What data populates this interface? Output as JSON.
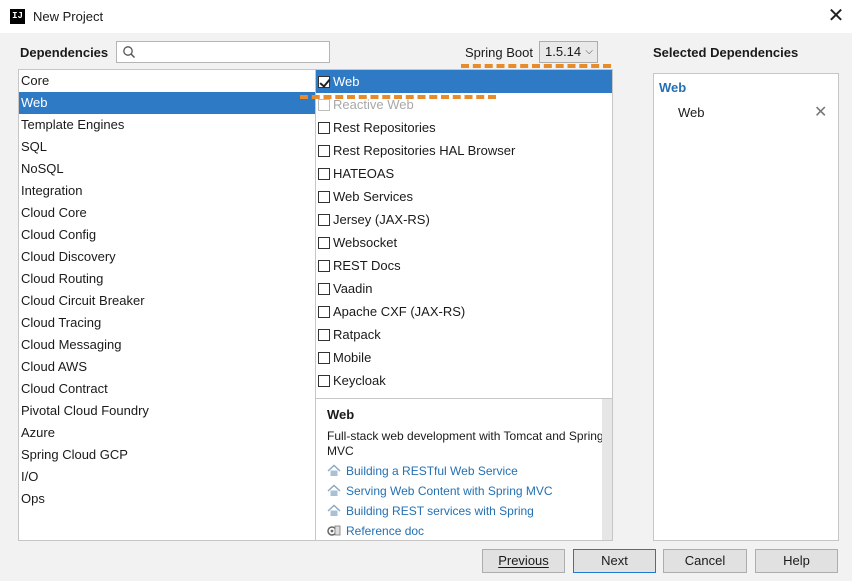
{
  "window": {
    "title": "New Project",
    "app_icon_text": "IJ",
    "close_glyph": "✕"
  },
  "header": {
    "dependencies_label": "Dependencies",
    "search": {
      "value": "",
      "placeholder": ""
    },
    "spring_boot_label": "Spring Boot",
    "spring_boot_version": "1.5.14",
    "selected_title": "Selected Dependencies"
  },
  "categories": [
    {
      "label": "Core"
    },
    {
      "label": "Web"
    },
    {
      "label": "Template Engines"
    },
    {
      "label": "SQL"
    },
    {
      "label": "NoSQL"
    },
    {
      "label": "Integration"
    },
    {
      "label": "Cloud Core"
    },
    {
      "label": "Cloud Config"
    },
    {
      "label": "Cloud Discovery"
    },
    {
      "label": "Cloud Routing"
    },
    {
      "label": "Cloud Circuit Breaker"
    },
    {
      "label": "Cloud Tracing"
    },
    {
      "label": "Cloud Messaging"
    },
    {
      "label": "Cloud AWS"
    },
    {
      "label": "Cloud Contract"
    },
    {
      "label": "Pivotal Cloud Foundry"
    },
    {
      "label": "Azure"
    },
    {
      "label": "Spring Cloud GCP"
    },
    {
      "label": "I/O"
    },
    {
      "label": "Ops"
    }
  ],
  "selected_category": "Web",
  "dependencies": [
    {
      "label": "Web",
      "checked": true,
      "disabled": false
    },
    {
      "label": "Reactive Web",
      "checked": false,
      "disabled": true
    },
    {
      "label": "Rest Repositories",
      "checked": false,
      "disabled": false
    },
    {
      "label": "Rest Repositories HAL Browser",
      "checked": false,
      "disabled": false
    },
    {
      "label": "HATEOAS",
      "checked": false,
      "disabled": false
    },
    {
      "label": "Web Services",
      "checked": false,
      "disabled": false
    },
    {
      "label": "Jersey (JAX-RS)",
      "checked": false,
      "disabled": false
    },
    {
      "label": "Websocket",
      "checked": false,
      "disabled": false
    },
    {
      "label": "REST Docs",
      "checked": false,
      "disabled": false
    },
    {
      "label": "Vaadin",
      "checked": false,
      "disabled": false
    },
    {
      "label": "Apache CXF (JAX-RS)",
      "checked": false,
      "disabled": false
    },
    {
      "label": "Ratpack",
      "checked": false,
      "disabled": false
    },
    {
      "label": "Mobile",
      "checked": false,
      "disabled": false
    },
    {
      "label": "Keycloak",
      "checked": false,
      "disabled": false
    }
  ],
  "description": {
    "title": "Web",
    "text": "Full-stack web development with Tomcat and Spring MVC",
    "links": [
      {
        "label": "Building a RESTful Web Service",
        "icon": "house-icon"
      },
      {
        "label": "Serving Web Content with Spring MVC",
        "icon": "house-icon"
      },
      {
        "label": "Building REST services with Spring",
        "icon": "house-icon"
      },
      {
        "label": "Reference doc",
        "icon": "gear-doc-icon"
      }
    ]
  },
  "selected_dependencies": {
    "group": "Web",
    "items": [
      {
        "label": "Web",
        "remove_glyph": "✕"
      }
    ]
  },
  "buttons": {
    "previous": "Previous",
    "next": "Next",
    "cancel": "Cancel",
    "help": "Help"
  },
  "colors": {
    "selection": "#2f7ac5",
    "link": "#2470b3",
    "annotation": "#e88b2a"
  }
}
